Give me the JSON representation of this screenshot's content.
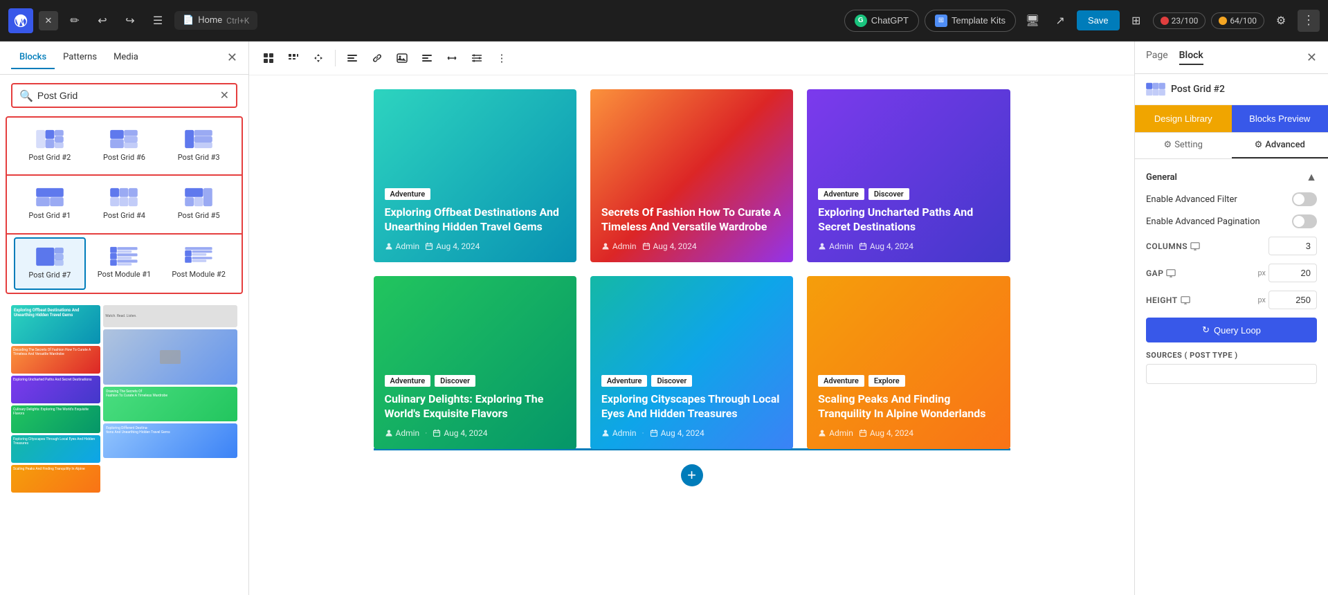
{
  "topbar": {
    "page_tab_label": "Home",
    "page_shortcut": "Ctrl+K",
    "chatgpt_label": "ChatGPT",
    "template_kits_label": "Template Kits",
    "save_label": "Save",
    "score1_label": "23/100",
    "score2_label": "64/100",
    "template_label": "Template"
  },
  "sidebar": {
    "tab_blocks": "Blocks",
    "tab_patterns": "Patterns",
    "tab_media": "Media",
    "search_placeholder": "Post Grid",
    "search_value": "Post Grid",
    "blocks": [
      {
        "id": "post-grid-2",
        "label": "Post Grid #2",
        "selected": false
      },
      {
        "id": "post-grid-6",
        "label": "Post Grid #6",
        "selected": false
      },
      {
        "id": "post-grid-3",
        "label": "Post Grid #3",
        "selected": false
      },
      {
        "id": "post-grid-1",
        "label": "Post Grid #1",
        "selected": false
      },
      {
        "id": "post-grid-4",
        "label": "Post Grid #4",
        "selected": false
      },
      {
        "id": "post-grid-5",
        "label": "Post Grid #5",
        "selected": false
      },
      {
        "id": "post-grid-7",
        "label": "Post Grid #7",
        "selected": true
      },
      {
        "id": "post-module-1",
        "label": "Post Module #1",
        "selected": false
      },
      {
        "id": "post-module-2",
        "label": "Post Module #2",
        "selected": false
      }
    ]
  },
  "canvas": {
    "posts_row1": [
      {
        "tags": [
          "Adventure"
        ],
        "title": "Exploring Offbeat Destinations And Unearthing Hidden Travel Gems",
        "author": "Admin",
        "date": "Aug 4, 2024",
        "bg": "bg-teal"
      },
      {
        "tags": [
          ""
        ],
        "title": "Secrets Of Fashion How To Curate A Timeless And Versatile Wardrobe",
        "author": "Admin",
        "date": "Aug 4, 2024",
        "bg": "bg-orange"
      },
      {
        "tags": [
          "Adventure",
          "Discover"
        ],
        "title": "Exploring Uncharted Paths And Secret Destinations",
        "author": "Admin",
        "date": "Aug 4, 2024",
        "bg": "bg-purple"
      }
    ],
    "posts_row2": [
      {
        "tags": [
          "Adventure",
          "Discover"
        ],
        "title": "Culinary Delights: Exploring The World's Exquisite Flavors",
        "author": "Admin",
        "date": "Aug 4, 2024",
        "bg": "bg-green"
      },
      {
        "tags": [
          "Adventure",
          "Discover"
        ],
        "title": "Exploring Cityscapes Through Local Eyes And Hidden Treasures",
        "author": "Admin",
        "date": "Aug 4, 2024",
        "bg": "bg-blue-green"
      },
      {
        "tags": [
          "Adventure",
          "Explore"
        ],
        "title": "Scaling Peaks And Finding Tranquility In Alpine Wonderlands",
        "author": "Admin",
        "date": "Aug 4, 2024",
        "bg": "bg-yellow"
      }
    ]
  },
  "right_panel": {
    "tab_page": "Page",
    "tab_block": "Block",
    "block_label": "Post Grid #2",
    "design_btn": "Design Library",
    "preview_btn": "Blocks Preview",
    "setting_tab": "Setting",
    "advanced_tab": "Advanced",
    "general_section": "General",
    "enable_advanced_filter": "Enable Advanced Filter",
    "enable_advanced_pagination": "Enable Advanced Pagination",
    "columns_label": "COLUMNS",
    "columns_value": "3",
    "gap_label": "GAP",
    "gap_unit": "px",
    "gap_value": "20",
    "height_label": "HEIGHT",
    "height_unit": "px",
    "height_value": "250",
    "query_loop_btn": "Query Loop",
    "sources_label": "SOURCES ( POST TYPE )"
  }
}
